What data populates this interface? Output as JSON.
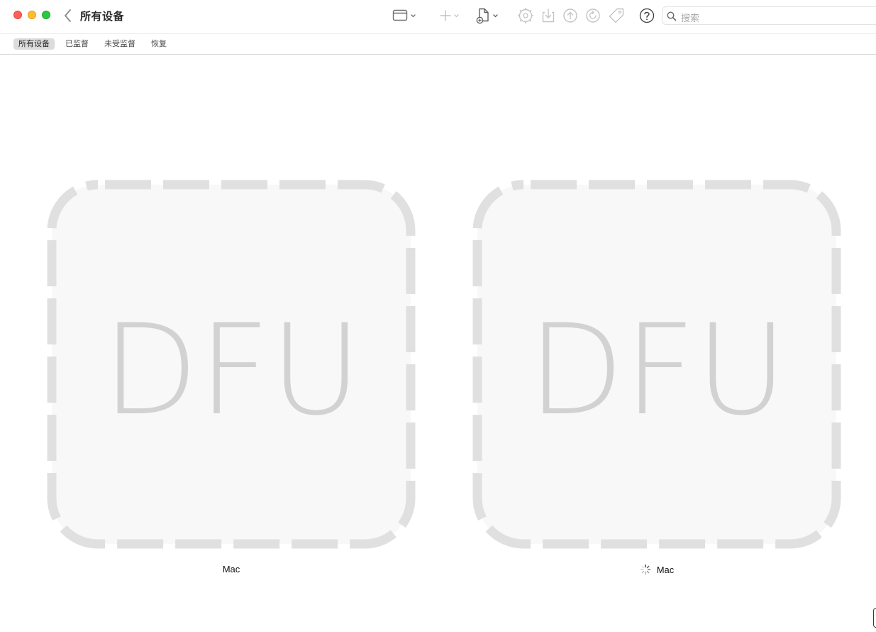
{
  "window": {
    "title": "所有设备"
  },
  "toolbar": {
    "icons": [
      "back-chevron-icon",
      "window-view-icon",
      "add-icon",
      "add-document-icon",
      "prepare-icon",
      "download-icon",
      "upload-icon",
      "restore-icon",
      "tag-icon",
      "help-icon"
    ]
  },
  "search": {
    "placeholder": "搜索"
  },
  "filters": [
    {
      "label": "所有设备",
      "active": true
    },
    {
      "label": "已监督",
      "active": false
    },
    {
      "label": "未受监督",
      "active": false
    },
    {
      "label": "恢复",
      "active": false
    }
  ],
  "devices": [
    {
      "tile_text": "DFU",
      "name": "Mac",
      "loading": false
    },
    {
      "tile_text": "DFU",
      "name": "Mac",
      "loading": true
    }
  ],
  "colors": {
    "tile_fill": "#f8f8f8",
    "tile_dash": "#e0e0e0",
    "dfu_text": "#d2d2d2",
    "close": "#fe5f57",
    "minimize": "#febc2e",
    "zoom": "#28c840"
  }
}
